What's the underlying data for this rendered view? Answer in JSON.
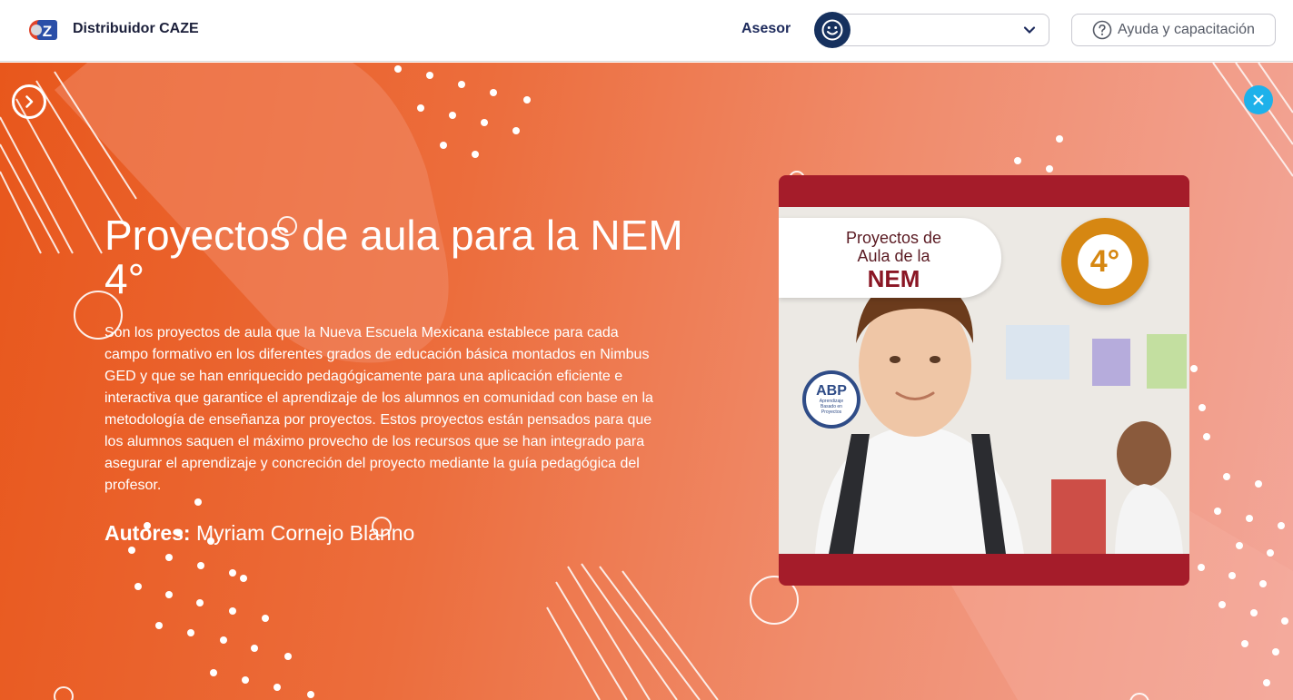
{
  "header": {
    "brand": "Distribuidor CAZE",
    "asesor_label": "Asesor",
    "asesor_value": "",
    "help_label": "Ayuda y capacitación"
  },
  "hero": {
    "title": "Proyectos de aula para la NEM 4°",
    "description": "Son los proyectos de aula que la Nueva Escuela Mexicana establece para cada campo formativo en los diferentes grados de educación básica montados en Nimbus GED y que se han enriquecido pedagógicamente para una aplicación eficiente e interactiva que garantice el aprendizaje de los alumnos en comunidad con base en la metodología de enseñanza por proyectos. Estos proyectos están pensados para que los alumnos saquen el máximo provecho de los recursos que se han integrado para asegurar el aprendizaje y concreción del proyecto mediante la guía pedagógica del profesor.",
    "authors_label": "Autores:",
    "authors_value": "Myriam Cornejo Blanno"
  },
  "cover": {
    "label_line1": "Proyectos de",
    "label_line2": "Aula de la",
    "label_line3": "NEM",
    "grade": "4°",
    "badge_title": "ABP",
    "badge_subtitle": "Aprendizaje Basado en Proyectos"
  },
  "colors": {
    "hero_start": "#e8571c",
    "hero_end": "#f3a79a",
    "close_button": "#1eb1ea",
    "cover_frame": "#a51c2a",
    "grade_badge": "#d68712",
    "avatar": "#16315e"
  },
  "icons": {
    "logo": "caze-logo-icon",
    "avatar": "smiley-icon",
    "dropdown": "chevron-down-icon",
    "help": "question-circle-icon",
    "next": "chevron-right-circle-icon",
    "close": "close-icon"
  }
}
